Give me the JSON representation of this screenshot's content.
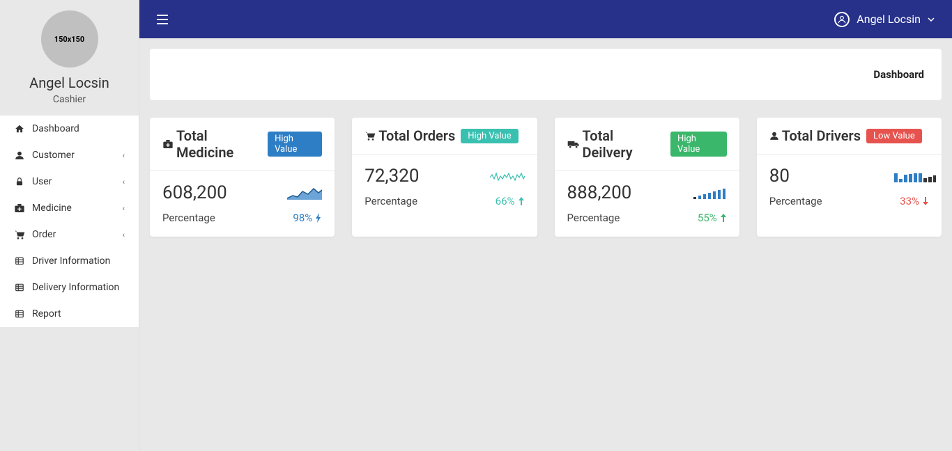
{
  "user": {
    "avatar_text": "150x150",
    "name": "Angel Locsin",
    "role": "Cashier"
  },
  "sidebar": {
    "items": [
      {
        "icon": "home",
        "label": "Dashboard",
        "expandable": false
      },
      {
        "icon": "user",
        "label": "Customer",
        "expandable": true
      },
      {
        "icon": "lock",
        "label": "User",
        "expandable": true
      },
      {
        "icon": "medkit",
        "label": "Medicine",
        "expandable": true
      },
      {
        "icon": "cart",
        "label": "Order",
        "expandable": true
      },
      {
        "icon": "list",
        "label": "Driver Information",
        "expandable": false
      },
      {
        "icon": "list",
        "label": "Delivery Information",
        "expandable": false
      },
      {
        "icon": "list",
        "label": "Report",
        "expandable": false
      }
    ]
  },
  "topbar": {
    "user_name": "Angel Locsin"
  },
  "breadcrumb": "Dashboard",
  "stats": [
    {
      "icon": "medkit",
      "title": "Total Medicine",
      "badge": "High Value",
      "badge_color": "blue",
      "value": "608,200",
      "percentage_label": "Percentage",
      "pct": "98%",
      "pct_color": "blue",
      "spark": "area",
      "trend_icon": "bolt"
    },
    {
      "icon": "cart",
      "title": "Total Orders",
      "badge": "High Value",
      "badge_color": "teal",
      "value": "72,320",
      "percentage_label": "Percentage",
      "pct": "66%",
      "pct_color": "teal",
      "spark": "line",
      "trend_icon": "up"
    },
    {
      "icon": "truck",
      "title": "Total Deilvery",
      "badge": "High Value",
      "badge_color": "green",
      "value": "888,200",
      "percentage_label": "Percentage",
      "pct": "55%",
      "pct_color": "green",
      "spark": "bars_up",
      "trend_icon": "up"
    },
    {
      "icon": "user",
      "title": "Total Drivers",
      "badge": "Low Value",
      "badge_color": "red",
      "value": "80",
      "percentage_label": "Percentage",
      "pct": "33%",
      "pct_color": "red",
      "spark": "bars_down",
      "trend_icon": "down"
    }
  ]
}
